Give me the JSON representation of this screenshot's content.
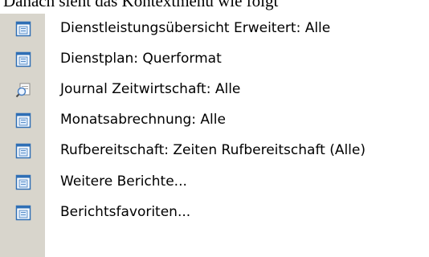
{
  "caption_text": "Danach sieht das Kontextmenü wie folgt",
  "menu": {
    "items": [
      {
        "label": "Dienstleistungsübersicht Erweitert: Alle",
        "icon": "report-document-icon"
      },
      {
        "label": "Dienstplan: Querformat",
        "icon": "report-document-icon"
      },
      {
        "label": "Journal Zeitwirtschaft: Alle",
        "icon": "journal-magnifier-icon"
      },
      {
        "label": "Monatsabrechnung: Alle",
        "icon": "report-document-icon"
      },
      {
        "label": "Rufbereitschaft: Zeiten Rufbereitschaft (Alle)",
        "icon": "report-document-icon"
      },
      {
        "label": "Weitere Berichte...",
        "icon": "report-document-icon"
      },
      {
        "label": "Berichtsfavoriten...",
        "icon": "report-document-icon"
      }
    ]
  },
  "colors": {
    "gutter": "#d8d5cc",
    "icon_frame": "#2f6fb5",
    "icon_fill": "#dcebfb"
  }
}
